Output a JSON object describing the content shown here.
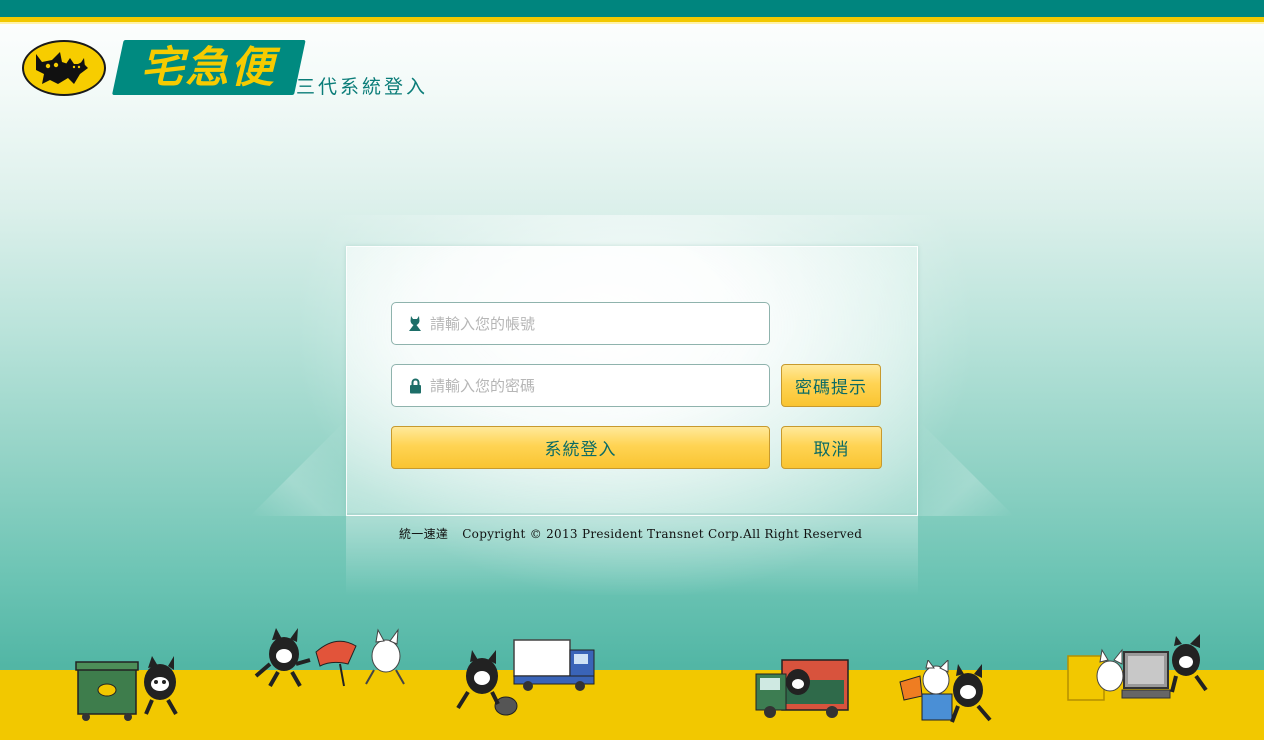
{
  "brand": {
    "name": "宅急便",
    "subtitle": "三代系統登入"
  },
  "login": {
    "username_placeholder": "請輸入您的帳號",
    "password_placeholder": "請輸入您的密碼",
    "hint_button": "密碼提示",
    "login_button": "系統登入",
    "cancel_button": "取消"
  },
  "footer": {
    "company": "統一速達",
    "copyright": "Copyright © 2013 President Transnet Corp.All Right Reserved"
  },
  "colors": {
    "teal": "#00857e",
    "yellow": "#f2c800",
    "button": "#ffd454"
  },
  "icons": {
    "user": "user-icon",
    "lock": "lock-icon"
  }
}
